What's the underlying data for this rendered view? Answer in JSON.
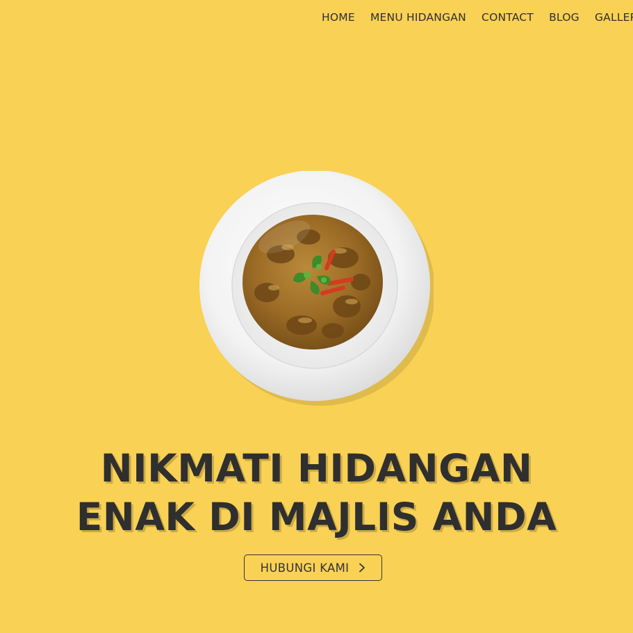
{
  "nav": {
    "items": [
      "HOME",
      "MENU HIDANGAN",
      "CONTACT",
      "BLOG",
      "GALLERY"
    ]
  },
  "hero": {
    "image_alt": "curry dish on white plate",
    "headline_line1": "NIKMATI HIDANGAN",
    "headline_line2": "ENAK DI MAJLIS ANDA",
    "cta_label": "HUBUNGI KAMI",
    "cta_icon": "chevron-right-icon"
  },
  "colors": {
    "background": "#f9d155",
    "text": "#2f2f2f",
    "curry": "#a9782c"
  }
}
